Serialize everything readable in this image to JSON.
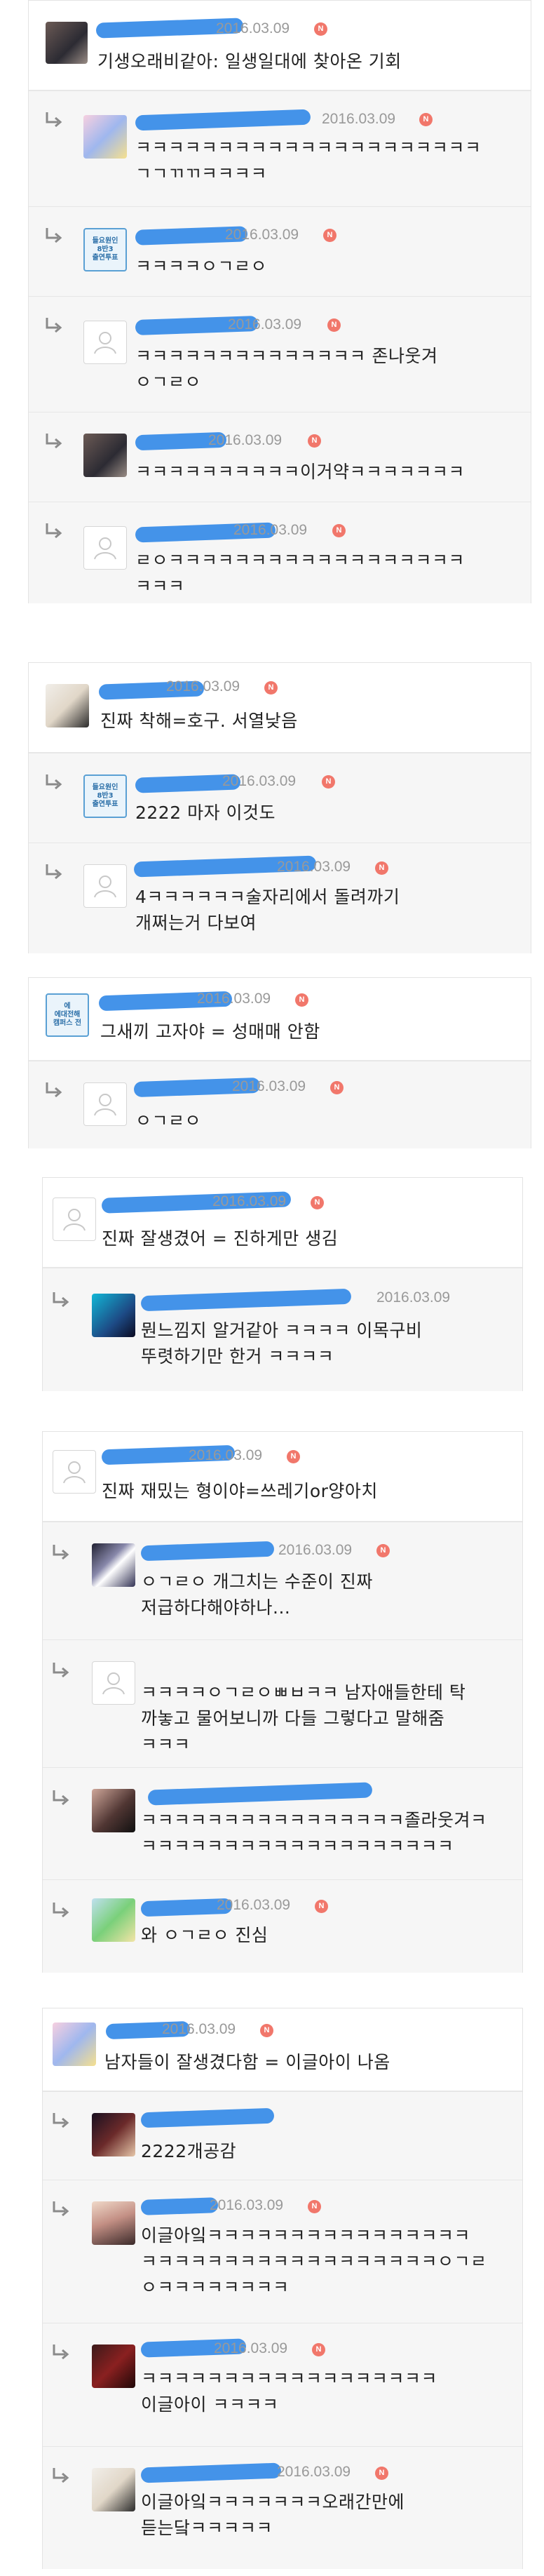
{
  "date": "2016.03.09",
  "new_badge": "N",
  "threads": [
    {
      "comments": [
        {
          "kind": "top",
          "avatar": "profile-photo",
          "badge_text": "",
          "author_hint": "",
          "meta": "2016.03.09",
          "text": "기생오래비같아: 일생일대에 찾아온 기회"
        },
        {
          "kind": "reply",
          "avatar": "cartoon-avatar",
          "meta": "2016.03.09",
          "text": "ㅋㅋㅋㅋㅋㅋㅋㅋㅋㅋㅋㅋㅋㅋㅋㅋㅋㅋㅋㅋㅋ\nㄱㄱㄲㄲㅋㅋㅋㅋ"
        },
        {
          "kind": "reply",
          "avatar": "badge",
          "badge_text": "들요원인\n8반3\n출연투표",
          "meta": "2016.03.09",
          "text": "ㅋㅋㅋㅋㅇㄱㄹㅇ"
        },
        {
          "kind": "reply",
          "avatar": "placeholder",
          "meta": "2016.03.09",
          "text": "ㅋㅋㅋㅋㅋㅋㅋㅋㅋㅋㅋㅋㅋㅋ 존나웃겨\nㅇㄱㄹㅇ"
        },
        {
          "kind": "reply",
          "avatar": "profile-photo",
          "meta": "2016.03.09",
          "text": "ㅋㅋㅋㅋㅋㅋㅋㅋㅋㅋ이거약ㅋㅋㅋㅋㅋㅋㅋ"
        },
        {
          "kind": "reply",
          "avatar": "placeholder",
          "meta": "2016.03.09",
          "text": "ㄹㅇㅋㅋㅋㅋㅋㅋㅋㅋㅋㅋㅋㅋㅋㅋㅋㅋㅋㅋ\nㅋㅋㅋ"
        }
      ]
    },
    {
      "comments": [
        {
          "kind": "top",
          "avatar": "profile-photo",
          "meta": "2016.03.09",
          "text": "진짜 착해=호구. 서열낮음"
        },
        {
          "kind": "reply",
          "avatar": "badge",
          "badge_text": "들요원인\n8반3\n출연투표",
          "meta": "2016.03.09",
          "text": "2222 마자 이것도"
        },
        {
          "kind": "reply",
          "avatar": "placeholder",
          "meta": "2016.03.09",
          "text": "4ㅋㅋㅋㅋㅋㅋ술자리에서 돌려까기\n개쩌는거 다보여"
        }
      ]
    },
    {
      "comments": [
        {
          "kind": "top",
          "avatar": "badge",
          "badge_text": "에\n에대전해\n캠퍼스 전",
          "meta": "2016.03.09",
          "text": "그새끼 고자야 = 성매매 안함"
        },
        {
          "kind": "reply",
          "avatar": "placeholder",
          "meta": "2016.03.09",
          "text": "ㅇㄱㄹㅇ"
        }
      ]
    },
    {
      "comments": [
        {
          "kind": "top",
          "avatar": "placeholder",
          "meta": "2016.03.09",
          "text": "진짜 잘생겼어 = 진하게만 생김"
        },
        {
          "kind": "reply",
          "avatar": "profile-photo",
          "meta": "2016.03.09",
          "text": "뭔느낌지 알거같아 ㅋㅋㅋㅋ 이목구비\n뚜렷하기만 한거 ㅋㅋㅋㅋ"
        }
      ]
    },
    {
      "comments": [
        {
          "kind": "top",
          "avatar": "placeholder",
          "meta": "2016.03.09",
          "text": "진짜 재밌는 형이야=쓰레기or양아치"
        },
        {
          "kind": "reply",
          "avatar": "profile-photo",
          "meta": "2016.03.09",
          "text": "ㅇㄱㄹㅇ 개그치는 수준이 진짜\n저급하다해야하나..."
        },
        {
          "kind": "reply",
          "avatar": "placeholder",
          "meta": "",
          "text": "ㅋㅋㅋㅋㅇㄱㄹㅇㅃㅂㅋㅋ 남자애들한테 탁\n까놓고 물어보니까 다들 그렇다고 말해줌\nㅋㅋㅋ"
        },
        {
          "kind": "reply",
          "avatar": "profile-photo",
          "meta": "",
          "text": "ㅋㅋㅋㅋㅋㅋㅋㅋㅋㅋㅋㅋㅋㅋㅋㅋ졸라웃겨ㅋ\nㅋㅋㅋㅋㅋㅋㅋㅋㅋㅋㅋㅋㅋㅋㅋㅋㅋㅋㅋ"
        },
        {
          "kind": "reply",
          "avatar": "profile-photo",
          "meta": "2016.03.09",
          "text": "와 ㅇㄱㄹㅇ 진심"
        }
      ]
    },
    {
      "comments": [
        {
          "kind": "top",
          "avatar": "profile-photo",
          "meta": "2016.03.09",
          "text": "남자들이 잘생겼다함 = 이글아이 나옴"
        },
        {
          "kind": "reply",
          "avatar": "profile-photo",
          "meta": "",
          "text": "2222개공감"
        },
        {
          "kind": "reply",
          "avatar": "profile-photo",
          "meta": "2016.03.09",
          "text": "이글아잌ㅋㅋㅋㅋㅋㅋㅋㅋㅋㅋㅋㅋㅋㅋㅋㅋ\nㅋㅋㅋㅋㅋㅋㅋㅋㅋㅋㅋㅋㅋㅋㅋㅋㅋㅋㅇㄱㄹ\nㅇㅋㅋㅋㅋㅋㅋㅋㅋ"
        },
        {
          "kind": "reply",
          "avatar": "profile-photo",
          "meta": "2016.03.09",
          "text": "ㅋㅋㅋㅋㅋㅋㅋㅋㅋㅋㅋㅋㅋㅋㅋㅋㅋㅋ\n이글아이 ㅋㅋㅋㅋ"
        },
        {
          "kind": "reply",
          "avatar": "profile-photo",
          "meta": "2016.03.09",
          "text": "이글아잌ㅋㅋㅋㅋㅋㅋㅋ오래간만에\n듣는닼ㅋㅋㅋㅋㅋ"
        }
      ]
    }
  ],
  "colors": {
    "redaction": "#3a8de8",
    "badge": "#f1776b",
    "reply_bg": "#f6f6f6",
    "meta_text": "#999999"
  },
  "icons": {
    "reply": "reply-arrow-icon",
    "placeholder_avatar": "default-user-icon",
    "new": "new-badge"
  }
}
